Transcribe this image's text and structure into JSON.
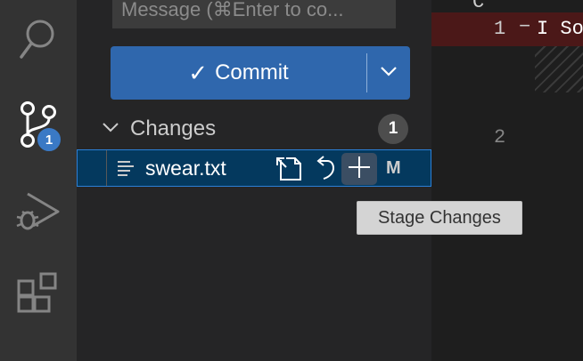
{
  "activity_bar": {
    "items": [
      {
        "icon": "search-icon"
      },
      {
        "icon": "source-control-icon",
        "badge": "1"
      },
      {
        "icon": "run-debug-icon"
      },
      {
        "icon": "extensions-icon"
      }
    ]
  },
  "scm": {
    "message_placeholder": "Message (⌘Enter to co...",
    "commit_label": "Commit",
    "commit_check": "✓",
    "changes_title": "Changes",
    "changes_count": "1",
    "files": [
      {
        "name": "swear.txt",
        "status": "M"
      }
    ]
  },
  "tooltip": "Stage Changes",
  "editor": {
    "top_line": "C",
    "lines": [
      {
        "number": "1",
        "marker": "−",
        "text": "I So"
      },
      {
        "number": "2",
        "text": ""
      }
    ]
  },
  "colors": {
    "accent": "#2f67ad",
    "badge": "#3a79c5",
    "diff_removed": "#4b1818",
    "selection": "#04395e"
  }
}
